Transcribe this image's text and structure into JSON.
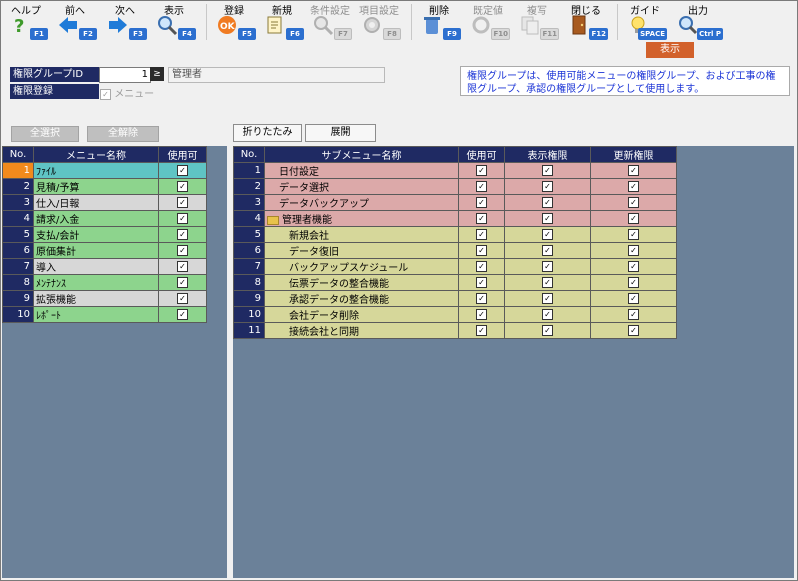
{
  "toolbar": [
    {
      "label": "ヘルプ",
      "key": "F1",
      "icon": "help-icon",
      "disabled": false
    },
    {
      "label": "前へ",
      "key": "F2",
      "icon": "arrow-left-icon",
      "disabled": false
    },
    {
      "label": "次へ",
      "key": "F3",
      "icon": "arrow-right-icon",
      "disabled": false
    },
    {
      "label": "表示",
      "key": "F4",
      "icon": "magnifier-icon",
      "disabled": false
    },
    {
      "label": "登録",
      "key": "F5",
      "icon": "ok-icon",
      "disabled": false
    },
    {
      "label": "新規",
      "key": "F6",
      "icon": "new-document-icon",
      "disabled": false
    },
    {
      "label": "条件設定",
      "key": "F7",
      "icon": "condition-icon",
      "disabled": true
    },
    {
      "label": "項目設定",
      "key": "F8",
      "icon": "item-settings-icon",
      "disabled": true
    },
    {
      "label": "削除",
      "key": "F9",
      "icon": "trash-icon",
      "disabled": false
    },
    {
      "label": "既定値",
      "key": "F10",
      "icon": "refresh-icon",
      "disabled": true
    },
    {
      "label": "複写",
      "key": "F11",
      "icon": "copy-icon",
      "disabled": true
    },
    {
      "label": "閉じる",
      "key": "F12",
      "icon": "door-icon",
      "disabled": false
    },
    {
      "label": "ガイド",
      "key": "SPACE",
      "icon": "lightbulb-icon",
      "disabled": false
    },
    {
      "label": "出力",
      "key": "Ctrl P",
      "icon": "print-icon",
      "disabled": false
    }
  ],
  "show_button": "表示",
  "header": {
    "group_id_label": "権限グループID",
    "group_id_value": "1",
    "lookup_button": "≥",
    "group_name": "管理者",
    "permission_label": "権限登録",
    "menu_checkbox_label": "メニュー"
  },
  "info_text": "権限グループは、使用可能メニューの権限グループ、および工事の権限グループ、承認の権限グループとして使用します。",
  "buttons": {
    "select_all": "全選択",
    "deselect_all": "全解除",
    "collapse": "折りたたみ",
    "expand": "展開"
  },
  "menu_table": {
    "headers": {
      "no": "No.",
      "name": "メニュー名称",
      "usable": "使用可"
    },
    "rows": [
      {
        "no": "1",
        "name": "ﾌｧｲﾙ",
        "color": "#5fc4c4",
        "checked": true,
        "selected": true
      },
      {
        "no": "2",
        "name": "見積/予算",
        "color": "#8dd48d",
        "checked": true
      },
      {
        "no": "3",
        "name": "仕入/日報",
        "color": "#d7d7d7",
        "checked": true
      },
      {
        "no": "4",
        "name": "請求/入金",
        "color": "#8dd48d",
        "checked": true
      },
      {
        "no": "5",
        "name": "支払/会計",
        "color": "#8dd48d",
        "checked": true
      },
      {
        "no": "6",
        "name": "原価集計",
        "color": "#8dd48d",
        "checked": true
      },
      {
        "no": "7",
        "name": "導入",
        "color": "#d7d7d7",
        "checked": true
      },
      {
        "no": "8",
        "name": "ﾒﾝﾃﾅﾝｽ",
        "color": "#8dd48d",
        "checked": true
      },
      {
        "no": "9",
        "name": "拡張機能",
        "color": "#d7d7d7",
        "checked": true
      },
      {
        "no": "10",
        "name": "ﾚﾎﾟｰﾄ",
        "color": "#8dd48d",
        "checked": true
      }
    ]
  },
  "submenu_table": {
    "headers": {
      "no": "No.",
      "name": "サブメニュー名称",
      "usable": "使用可",
      "view": "表示権限",
      "update": "更新権限"
    },
    "rows": [
      {
        "no": "1",
        "name": "日付設定",
        "level": 1,
        "color": "#dca9a9",
        "usable": true,
        "view": true,
        "update": true
      },
      {
        "no": "2",
        "name": "データ選択",
        "level": 1,
        "color": "#dca9a9",
        "usable": true,
        "view": true,
        "update": true
      },
      {
        "no": "3",
        "name": "データバックアップ",
        "level": 1,
        "color": "#dca9a9",
        "usable": true,
        "view": true,
        "update": true
      },
      {
        "no": "4",
        "name": "管理者機能",
        "level": 0,
        "folder": true,
        "color": "#dca9a9",
        "usable": true,
        "view": true,
        "update": true
      },
      {
        "no": "5",
        "name": "新規会社",
        "level": 2,
        "color": "#d6d79a",
        "usable": true,
        "view": true,
        "update": true
      },
      {
        "no": "6",
        "name": "データ復旧",
        "level": 2,
        "color": "#d6d79a",
        "usable": true,
        "view": true,
        "update": true
      },
      {
        "no": "7",
        "name": "バックアップスケジュール",
        "level": 2,
        "color": "#d6d79a",
        "usable": true,
        "view": true,
        "update": true
      },
      {
        "no": "8",
        "name": "伝票データの整合機能",
        "level": 2,
        "color": "#d6d79a",
        "usable": true,
        "view": true,
        "update": true
      },
      {
        "no": "9",
        "name": "承認データの整合機能",
        "level": 2,
        "color": "#d6d79a",
        "usable": true,
        "view": true,
        "update": true
      },
      {
        "no": "10",
        "name": "会社データ削除",
        "level": 2,
        "color": "#d6d79a",
        "usable": true,
        "view": true,
        "update": true
      },
      {
        "no": "11",
        "name": "接続会社と同期",
        "level": 2,
        "color": "#d6d79a",
        "usable": true,
        "view": true,
        "update": true
      }
    ]
  },
  "colors": {
    "header_navy": "#1f2a63",
    "panel_bg": "#6b8199",
    "selected_orange": "#f28a1c",
    "info_blue": "#1b34d6"
  }
}
